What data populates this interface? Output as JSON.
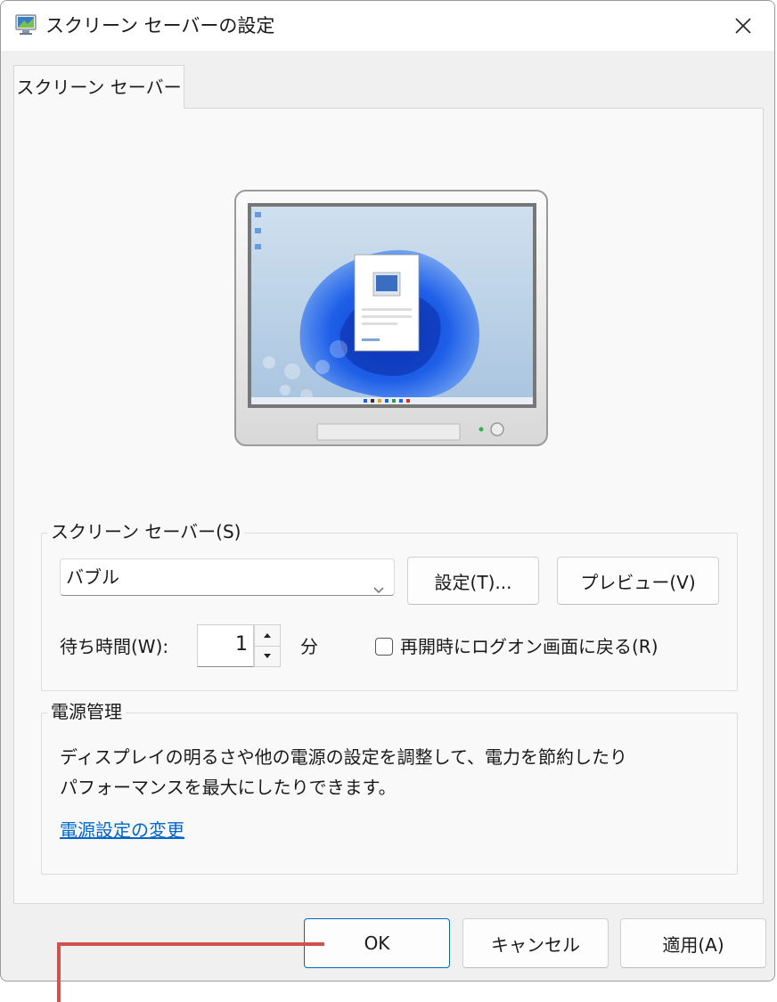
{
  "window": {
    "title": "スクリーン セーバーの設定",
    "close_label": "×"
  },
  "tabs": [
    {
      "label": "スクリーン セーバー",
      "selected": true
    }
  ],
  "screensaver_group": {
    "label": "スクリーン セーバー(S)",
    "selected_value": "バブル",
    "settings_button": "設定(T)...",
    "preview_button": "プレビュー(V)",
    "wait_label": "待ち時間(W):",
    "wait_value": "1",
    "wait_unit": "分",
    "resume_checkbox_label": "再開時にログオン画面に戻る(R)",
    "resume_checked": false
  },
  "power_group": {
    "label": "電源管理",
    "description_line1": "ディスプレイの明るさや他の電源の設定を調整して、電力を節約したり",
    "description_line2": "パフォーマンスを最大にしたりできます。",
    "link": "電源設定の変更"
  },
  "footer": {
    "ok": "OK",
    "cancel": "キャンセル",
    "apply": "適用(A)"
  },
  "colors": {
    "accent": "#0067c0",
    "link": "#0066cc",
    "annotation": "#d0524e"
  }
}
